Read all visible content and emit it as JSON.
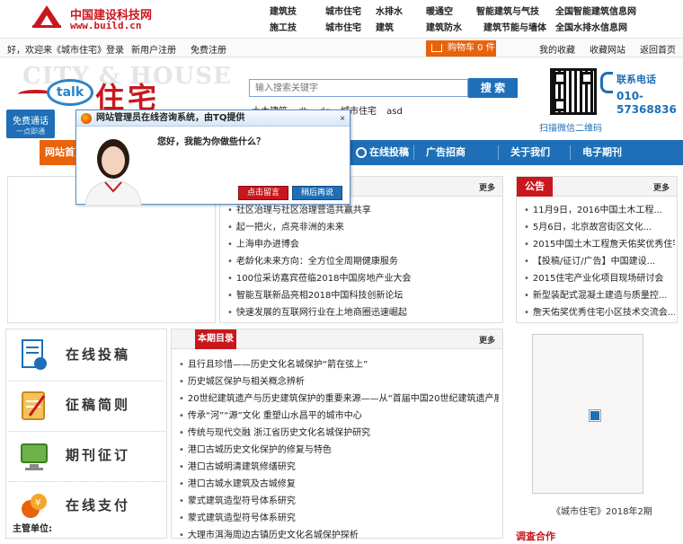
{
  "site": {
    "name_cn": "中国建设科技网",
    "url": "www.build.cn"
  },
  "topnav": {
    "row1": [
      "建筑技",
      "城市住宅",
      "水排水",
      "暖通空",
      "智能建筑与气技",
      "全国智能建筑信息网"
    ],
    "row2": [
      "施工技",
      "城市住宅",
      "建筑",
      "建筑防水",
      "建筑节能与墙体",
      "全国水排水信息网"
    ]
  },
  "login": {
    "greeting": "好，欢迎来《城市住宅》",
    "login_label": "登录",
    "register_label": "新用户注册",
    "free_register": "免费注册",
    "cart_label": "购物车 0 件",
    "my_favorites": "我的收藏",
    "collect_site": "收藏网站",
    "back_home": "返回首页"
  },
  "brand": {
    "bg_text": "CITY & HOUSE",
    "talk": "talk",
    "cn": "住宅",
    "free_call": "免费通话",
    "free_call_sub": "一点即通"
  },
  "search": {
    "placeholder": "输入搜索关键字",
    "button": "搜 索",
    "hot": [
      "土木建筑",
      "dh",
      "dq",
      "城市住宅",
      "asd"
    ]
  },
  "contact": {
    "qr_label": "扫描微信二维码",
    "phone_label": "联系电话",
    "phone_line1": "010-",
    "phone_line2": "57368836"
  },
  "mainnav": {
    "items": [
      "网站首页",
      "在线投稿",
      "广告招商",
      "关于我们",
      "电子期刊"
    ]
  },
  "news": {
    "more": "更多",
    "items": [
      "社区治理与社区治理营造共赢共享",
      "起一把火，点亮非洲的未来",
      "上海申办进博会",
      "老龄化未来方向：全方位全周期健康服务",
      "100位采访嘉宾莅临2018中国房地产业大会",
      "智能互联新品亮相2018中国科技创新论坛",
      "快速发展的互联网行业在上地商圈迅速崛起"
    ]
  },
  "notice": {
    "title": "公告",
    "more": "更多",
    "items": [
      "11月9日，2016中国土木工程...",
      "5月6日，北京故宫街区文化...",
      "2015中国土木工程詹天佑奖优秀住宅...",
      "【投稿/征订/广告】中国建设...",
      "2015住宅产业化项目现场研讨会",
      "新型装配式混凝土建造与质量控...",
      "詹天佑奖优秀住宅小区技术交流会..."
    ]
  },
  "issue": {
    "title": "本期目录",
    "more": "更多",
    "items": [
      "且行且珍惜——历史文化名城保护“箭在弦上”",
      "历史城区保护与相关概念辨析",
      "20世纪建筑遗产与历史建筑保护的重要来源——从“首届中国20世纪建筑遗产展”说起",
      "传承“河”“源”文化 重塑山水昌平的城市中心",
      "传统与现代交融 浙江省历史文化名城保护研究",
      "港口古城历史文化保护的修复与特色",
      "港口古城明清建筑修缮研究",
      "港口古城水建筑及古城修复",
      "蒙式建筑造型符号体系研究",
      "蒙式建筑造型符号体系研究",
      "大理市洱海周边古镇历史文化名城保护探析"
    ]
  },
  "services": {
    "items": [
      "在线投稿",
      "征稿简则",
      "期刊征订",
      "在线支付"
    ],
    "editor_label": "主管单位:"
  },
  "magazine": {
    "caption": "《城市住宅》2018年2期",
    "coop_label": "调査合作"
  },
  "chat": {
    "title": "网站管理员在线咨询系统，由TQ提供",
    "message": "您好，我能为你做些什么？",
    "btn_talk": "点击留言",
    "btn_later": "稍后再说",
    "close": "×"
  },
  "colors": {
    "brand_red": "#c8171e",
    "brand_blue": "#1e6fb7",
    "accent_orange": "#e8630a"
  }
}
